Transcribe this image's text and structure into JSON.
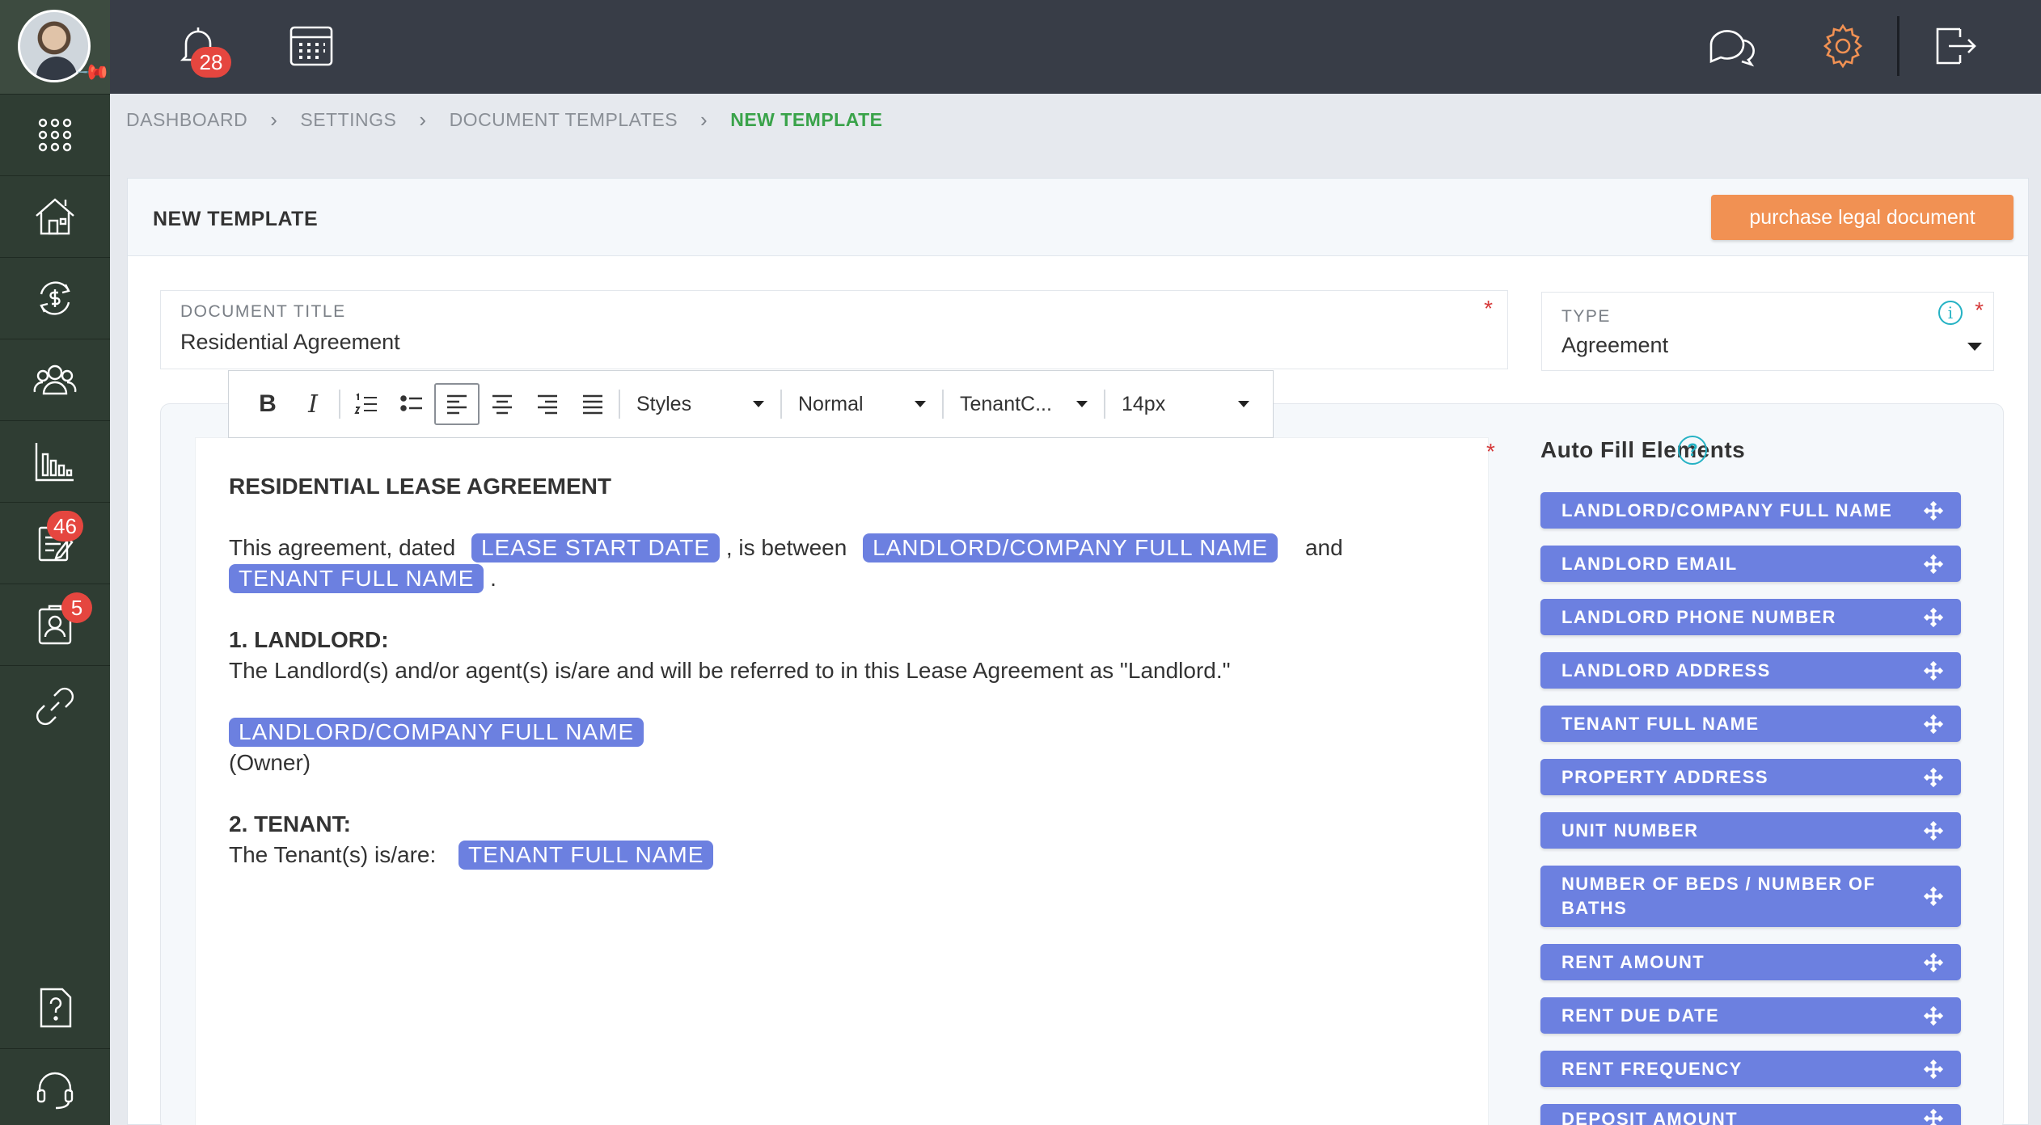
{
  "topbar": {
    "notification_count": "28"
  },
  "sidebar": {
    "badges": {
      "tasks": "46",
      "contacts": "5"
    }
  },
  "breadcrumb": [
    "DASHBOARD",
    "SETTINGS",
    "DOCUMENT TEMPLATES",
    "NEW TEMPLATE"
  ],
  "page": {
    "title": "NEW TEMPLATE",
    "purchase_button": "purchase legal document"
  },
  "form": {
    "document_title_label": "DOCUMENT TITLE",
    "document_title_value": "Residential Agreement",
    "type_label": "TYPE",
    "type_value": "Agreement",
    "required_mark": "*",
    "info_glyph": "i"
  },
  "toolbar": {
    "bold": "B",
    "italic": "I",
    "styles": "Styles",
    "format": "Normal",
    "font": "TenantC...",
    "size": "14px"
  },
  "document": {
    "heading": "RESIDENTIAL LEASE AGREEMENT",
    "intro_1": "This agreement, dated",
    "chip_lease_start": "LEASE START DATE",
    "intro_2": ", is between",
    "chip_landlord": "LANDLORD/COMPANY FULL NAME",
    "intro_3": "and",
    "chip_tenant": "TENANT FULL NAME",
    "intro_4": ".",
    "section1_title": "1. LANDLORD:",
    "section1_text": "The Landlord(s) and/or agent(s) is/are and will be referred to in this Lease Agreement as \"Landlord.\"",
    "section1_chip": "LANDLORD/COMPANY FULL NAME",
    "owner": "(Owner)",
    "section2_title": "2. TENANT:",
    "section2_text": "The Tenant(s) is/are:",
    "section2_chip": "TENANT FULL NAME"
  },
  "autofill": {
    "title": "Auto Fill Elements",
    "help_glyph": "?",
    "items": [
      "LANDLORD/COMPANY FULL NAME",
      "LANDLORD EMAIL",
      "LANDLORD PHONE NUMBER",
      "LANDLORD ADDRESS",
      "TENANT FULL NAME",
      "PROPERTY ADDRESS",
      "UNIT NUMBER",
      "NUMBER OF BEDS / NUMBER OF BATHS",
      "RENT AMOUNT",
      "RENT DUE DATE",
      "RENT FREQUENCY",
      "DEPOSIT AMOUNT"
    ]
  },
  "colors": {
    "accent_orange": "#f19153",
    "chip_blue": "#6c80e0",
    "breadcrumb_active": "#3aa34a",
    "sidebar": "#2f3d33",
    "topbar": "#383d47",
    "badge_red": "#e5463f"
  }
}
